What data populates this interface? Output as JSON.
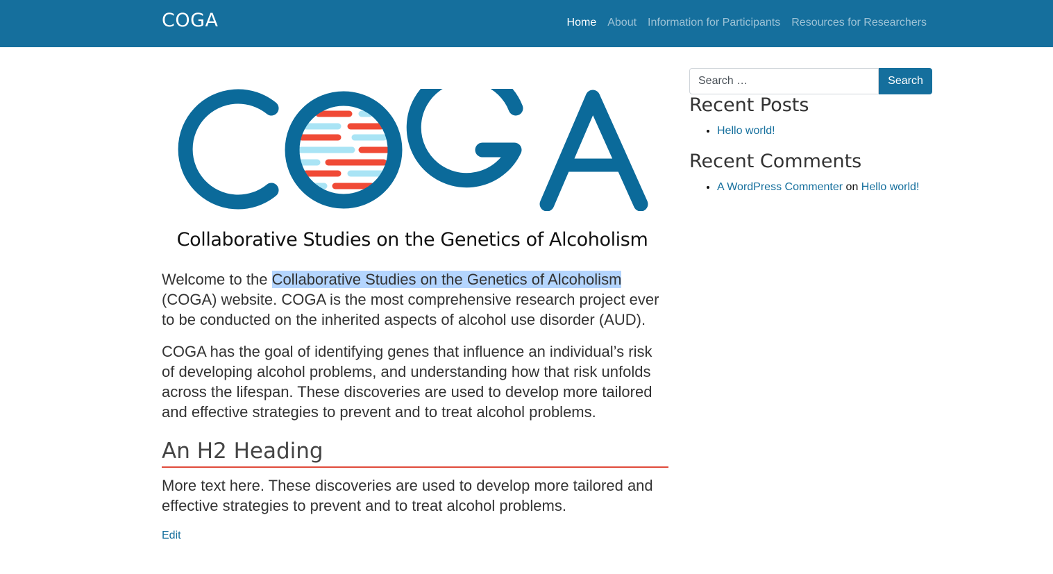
{
  "site": {
    "brand": "COGA"
  },
  "nav": {
    "items": [
      {
        "label": "Home",
        "active": true
      },
      {
        "label": "About",
        "active": false
      },
      {
        "label": "Information for Participants",
        "active": false
      },
      {
        "label": "Resources for Researchers",
        "active": false
      }
    ]
  },
  "hero": {
    "logo_text": "COGA",
    "tagline": "Collaborative Studies on the Genetics of Alcoholism"
  },
  "content": {
    "p1_before": "Welcome to the ",
    "p1_highlight": "Collaborative Studies on the Genetics of Alcoholism",
    "p1_after": " (COGA) website.  COGA is the most comprehensive research project ever to be conducted on the inherited aspects of alcohol use disorder (AUD).",
    "p2": "COGA has the goal of identifying genes that influence an individual’s risk of developing alcohol problems, and understanding how that risk unfolds across the lifespan. These discoveries are used to develop more tailored and effective strategies to prevent and to treat alcohol problems.",
    "h2": "An H2 Heading",
    "p3": "More text here. These discoveries are used to develop more tailored and effective strategies to prevent and to treat alcohol problems.",
    "edit_label": "Edit"
  },
  "sidebar": {
    "search_placeholder": "Search …",
    "search_button": "Search",
    "recent_posts_title": "Recent Posts",
    "recent_posts": [
      "Hello world!"
    ],
    "recent_comments_title": "Recent Comments",
    "comment": {
      "author": "A WordPress Commenter",
      "connector": " on ",
      "post": "Hello world!"
    }
  },
  "colors": {
    "primary": "#156f9d",
    "accent_red": "#e04a3a",
    "logo_blue": "#0b6a9a",
    "logo_light_blue": "#a9e4f5",
    "highlight": "#b4d5fe"
  }
}
